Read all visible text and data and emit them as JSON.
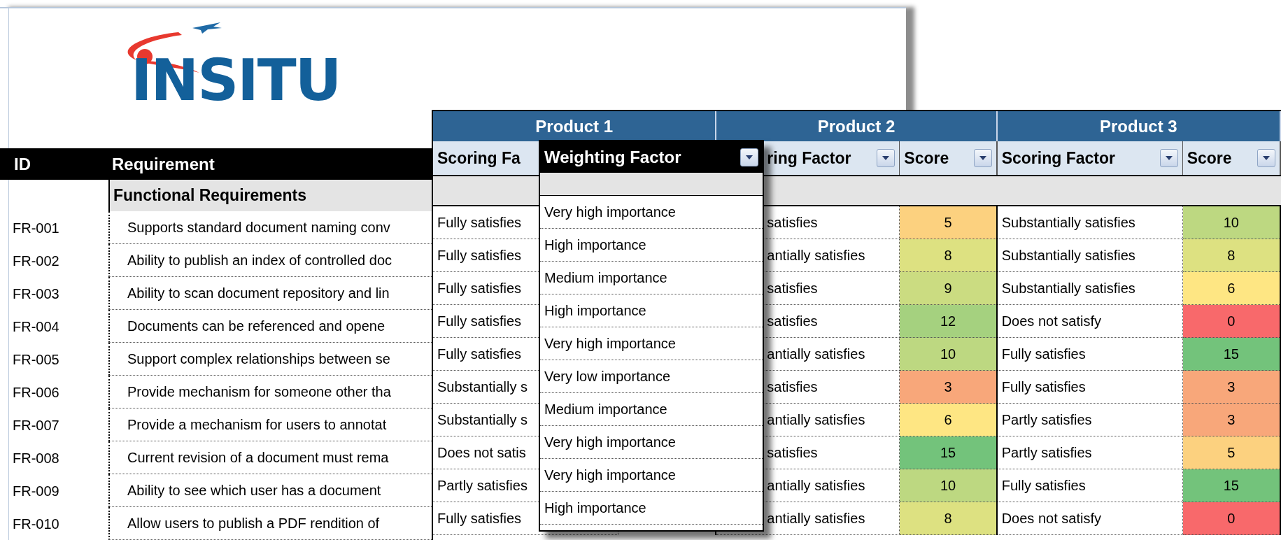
{
  "logo": {
    "text": "INSITU"
  },
  "requirements_table": {
    "columns": [
      "ID",
      "Requirement"
    ],
    "section": "Functional Requirements",
    "rows": [
      {
        "id": "FR-001",
        "requirement": "Supports standard document naming conv"
      },
      {
        "id": "FR-002",
        "requirement": "Ability to publish an index of controlled doc"
      },
      {
        "id": "FR-003",
        "requirement": "Ability to scan document repository and lin"
      },
      {
        "id": "FR-004",
        "requirement": "Documents can be referenced and opene"
      },
      {
        "id": "FR-005",
        "requirement": "Support complex relationships between se"
      },
      {
        "id": "FR-006",
        "requirement": "Provide mechanism for someone other tha"
      },
      {
        "id": "FR-007",
        "requirement": "Provide a mechanism for users to annotat"
      },
      {
        "id": "FR-008",
        "requirement": "Current revision of a document must rema"
      },
      {
        "id": "FR-009",
        "requirement": "Ability to see which user has a document"
      },
      {
        "id": "FR-010",
        "requirement": "Allow users to publish a PDF rendition of"
      }
    ]
  },
  "products_table": {
    "products": [
      {
        "name": "Product 1",
        "columns": [
          "Scoring Fa"
        ],
        "rows": [
          {
            "scoring_factor": "Fully satisfies"
          },
          {
            "scoring_factor": "Fully satisfies"
          },
          {
            "scoring_factor": "Fully satisfies"
          },
          {
            "scoring_factor": "Fully satisfies"
          },
          {
            "scoring_factor": "Fully satisfies"
          },
          {
            "scoring_factor": "Substantially s"
          },
          {
            "scoring_factor": "Substantially s"
          },
          {
            "scoring_factor": "Does not satis"
          },
          {
            "scoring_factor": "Partly satisfies"
          },
          {
            "scoring_factor": "Fully satisfies"
          }
        ]
      },
      {
        "name": "Product 2",
        "columns": [
          "ring Factor",
          "Score"
        ],
        "rows": [
          {
            "scoring_factor": "satisfies",
            "score": "5",
            "color": "#fcd17f"
          },
          {
            "scoring_factor": "antially satisfies",
            "score": "8",
            "color": "#dde181"
          },
          {
            "scoring_factor": "satisfies",
            "score": "9",
            "color": "#cbdc81"
          },
          {
            "scoring_factor": "satisfies",
            "score": "12",
            "color": "#a5d17f"
          },
          {
            "scoring_factor": "antially satisfies",
            "score": "10",
            "color": "#bdd881"
          },
          {
            "scoring_factor": "satisfies",
            "score": "3",
            "color": "#f8a77a"
          },
          {
            "scoring_factor": "antially satisfies",
            "score": "6",
            "color": "#fee683"
          },
          {
            "scoring_factor": "satisfies",
            "score": "15",
            "color": "#73c37b"
          },
          {
            "scoring_factor": "antially satisfies",
            "score": "10",
            "color": "#bdd881"
          },
          {
            "scoring_factor": "antially satisfies",
            "score": "8",
            "color": "#dde181"
          }
        ]
      },
      {
        "name": "Product 3",
        "columns": [
          "Scoring Factor",
          "Score"
        ],
        "rows": [
          {
            "scoring_factor": "Substantially satisfies",
            "score": "10",
            "color": "#bdd881"
          },
          {
            "scoring_factor": "Substantially satisfies",
            "score": "8",
            "color": "#dde181"
          },
          {
            "scoring_factor": "Substantially satisfies",
            "score": "6",
            "color": "#fee683"
          },
          {
            "scoring_factor": "Does not satisfy",
            "score": "0",
            "color": "#f8696b"
          },
          {
            "scoring_factor": "Fully satisfies",
            "score": "15",
            "color": "#73c37b"
          },
          {
            "scoring_factor": "Fully satisfies",
            "score": "3",
            "color": "#f8a77a"
          },
          {
            "scoring_factor": "Partly satisfies",
            "score": "3",
            "color": "#f8a77a"
          },
          {
            "scoring_factor": "Partly satisfies",
            "score": "5",
            "color": "#fcd17f"
          },
          {
            "scoring_factor": "Fully satisfies",
            "score": "15",
            "color": "#73c37b"
          },
          {
            "scoring_factor": "Does not satisfy",
            "score": "0",
            "color": "#f8696b"
          }
        ]
      }
    ]
  },
  "weighting_popup": {
    "header": "Weighting Factor",
    "items": [
      "Very high importance",
      "High importance",
      "Medium importance",
      "High importance",
      "Very high importance",
      "Very low importance",
      "Medium importance",
      "Very high importance",
      "Very high importance",
      "High importance"
    ]
  }
}
